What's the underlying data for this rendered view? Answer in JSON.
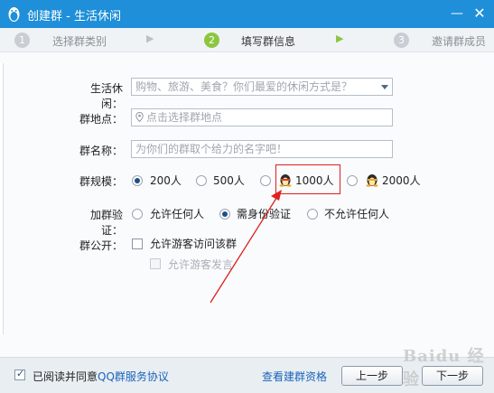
{
  "window": {
    "title": "创建群 - 生活休闲",
    "minimize_glyph": "—",
    "close_glyph": "✕"
  },
  "steps": [
    {
      "number": "1",
      "label": "选择群类别",
      "active": false
    },
    {
      "number": "2",
      "label": "填写群信息",
      "active": true
    },
    {
      "number": "3",
      "label": "邀请群成员",
      "active": false
    }
  ],
  "form": {
    "category": {
      "label": "生活休闲：",
      "placeholder": "购物、旅游、美食？你们最爱的休闲方式是？"
    },
    "location": {
      "label": "群地点：",
      "placeholder": "点击选择群地点"
    },
    "name": {
      "label": "群名称：",
      "placeholder": "为你们的群取个给力的名字吧！"
    },
    "size": {
      "label": "群规模：",
      "options": [
        "200人",
        "500人",
        "1000人",
        "2000人"
      ],
      "selected": "200人"
    },
    "verify": {
      "label": "加群验证：",
      "options": [
        "允许任何人",
        "需身份验证",
        "不允许任何人"
      ],
      "selected": "需身份验证"
    },
    "public": {
      "label": "群公开：",
      "allow_visitors": "允许游客访问该群",
      "allow_visitor_speech": "允许游客发言"
    }
  },
  "footer": {
    "agree_text": "已阅读并同意",
    "agree_link": "QQ群服务协议",
    "qualification_link": "查看建群资格",
    "prev_button": "上一步",
    "next_button": "下一步"
  },
  "icons": {
    "app": "qq-penguin-icon",
    "location": "location-pin-icon",
    "dropdown": "chevron-down-icon",
    "vip_1000": "qq-member-penguin-icon",
    "vip_2000": "qq-member-penguin-icon"
  },
  "watermark": "Baidu 经验",
  "colors": {
    "titlebar": "#1e8fd8",
    "active_step": "#8cc63f",
    "link": "#1a64b8",
    "highlight": "#e02020"
  }
}
